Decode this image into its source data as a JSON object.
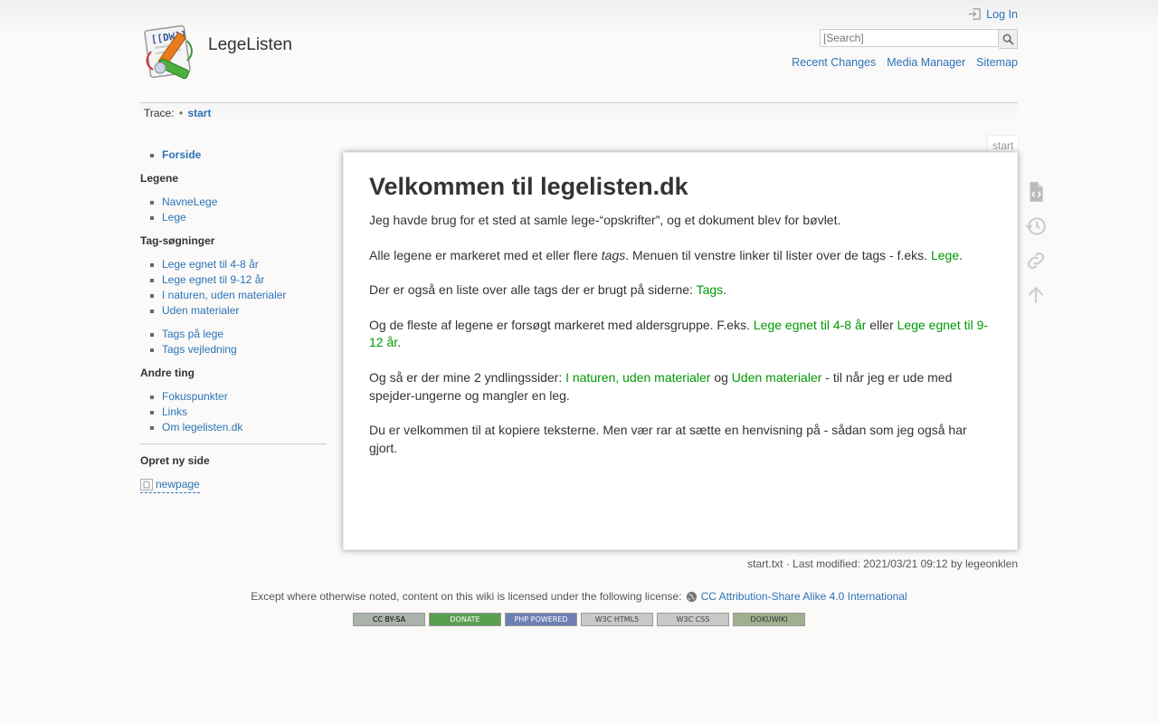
{
  "site": {
    "title": "LegeListen",
    "logo_icon": "dokuwiki-logo-icon"
  },
  "user": {
    "login_label": "Log In"
  },
  "search": {
    "placeholder": "[Search]",
    "button_label": "Search"
  },
  "usertools": {
    "recent": "Recent Changes",
    "media": "Media Manager",
    "sitemap": "Sitemap"
  },
  "breadcrumbs": {
    "label": "Trace:",
    "bullet": "•",
    "current": "start"
  },
  "sidebar": {
    "top_item": "Forside",
    "sections": [
      {
        "heading": "Legene",
        "groups": [
          [
            "NavneLege",
            "Lege"
          ]
        ]
      },
      {
        "heading": "Tag-søgninger",
        "groups": [
          [
            "Lege egnet til 4-8 år",
            "Lege egnet til 9-12 år",
            "I naturen, uden materialer",
            "Uden materialer"
          ],
          [
            "Tags på lege",
            "Tags vejledning"
          ]
        ]
      },
      {
        "heading": "Andre ting",
        "groups": [
          [
            "Fokuspunkter",
            "Links",
            "Om legelisten.dk"
          ]
        ]
      }
    ],
    "new_page_heading": "Opret ny side",
    "new_page_link": "newpage"
  },
  "page": {
    "id": "start",
    "title": "Velkommen til legelisten.dk",
    "p1": "Jeg havde brug for et sted at samle lege-“opskrifter”, og et dokument blev for bøvlet.",
    "p2_a": "Alle legene er markeret med et eller flere ",
    "p2_em": "tags",
    "p2_b": ". Menuen til venstre linker til lister over de tags - f.eks. ",
    "p2_link": "Lege",
    "p2_c": ".",
    "p3_a": "Der er også en liste over alle tags der er brugt på siderne: ",
    "p3_link": "Tags",
    "p3_b": ".",
    "p4_a": "Og de fleste af legene er forsøgt markeret med aldersgruppe. F.eks. ",
    "p4_link1": "Lege egnet til 4-8 år",
    "p4_b": " eller ",
    "p4_link2": "Lege egnet til 9-12 år",
    "p4_c": ".",
    "p5_a": "Og så er der mine 2 yndlingssider: ",
    "p5_link1": "I naturen, uden materialer",
    "p5_b": " og ",
    "p5_link2": "Uden materialer",
    "p5_c": " - til når jeg er ude med spejder-ungerne og mangler en leg.",
    "p6": "Du er velkommen til at kopiere teksterne. Men vær rar at sætte en henvisning på - sådan som jeg også har gjort."
  },
  "pagetools": [
    "show-source-icon",
    "old-revisions-icon",
    "backlinks-icon",
    "back-to-top-icon"
  ],
  "docinfo": "start.txt · Last modified: 2021/03/21 09:12 by legeonklen",
  "footer": {
    "license_text": "Except where otherwise noted, content on this wiki is licensed under the following license:",
    "license_link": "CC Attribution-Share Alike 4.0 International",
    "badges": [
      "CC BY-SA",
      "DONATE",
      "PHP POWERED",
      "W3C HTML5",
      "W3C CSS",
      "DOKUWIKI"
    ]
  },
  "colors": {
    "link": "#2b73b7",
    "wikilink": "#009900",
    "text": "#333333",
    "background": "#fbfaf9"
  }
}
